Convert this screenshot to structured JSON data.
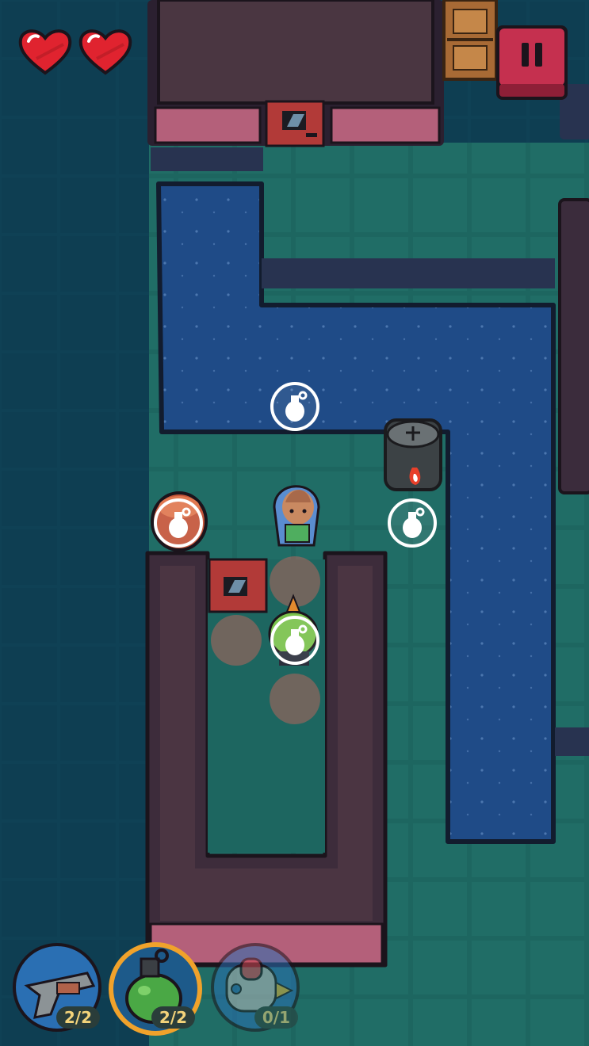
{
  "hud": {
    "hearts": [
      {
        "icon": "heart-icon",
        "filled": true
      },
      {
        "icon": "heart-icon",
        "filled": true
      }
    ],
    "pause_icon": "pause-icon"
  },
  "weapons": [
    {
      "name": "pistol",
      "ammo": "2/2",
      "selected": false,
      "enabled": true
    },
    {
      "name": "grenade",
      "ammo": "2/2",
      "selected": true,
      "enabled": true
    },
    {
      "name": "rocket",
      "ammo": "0/1",
      "selected": false,
      "enabled": false
    }
  ],
  "targets": [
    {
      "icon": "grenade-target-icon"
    },
    {
      "icon": "grenade-target-icon"
    },
    {
      "icon": "grenade-target-icon"
    },
    {
      "icon": "grenade-target-icon"
    }
  ],
  "colors": {
    "water": "#1e4a86",
    "floor": "#1f6a63",
    "wall_top": "#3c2d3c",
    "heart": "#e0232f",
    "pause": "#c5304f",
    "slot_highlight": "#f0a22b"
  }
}
